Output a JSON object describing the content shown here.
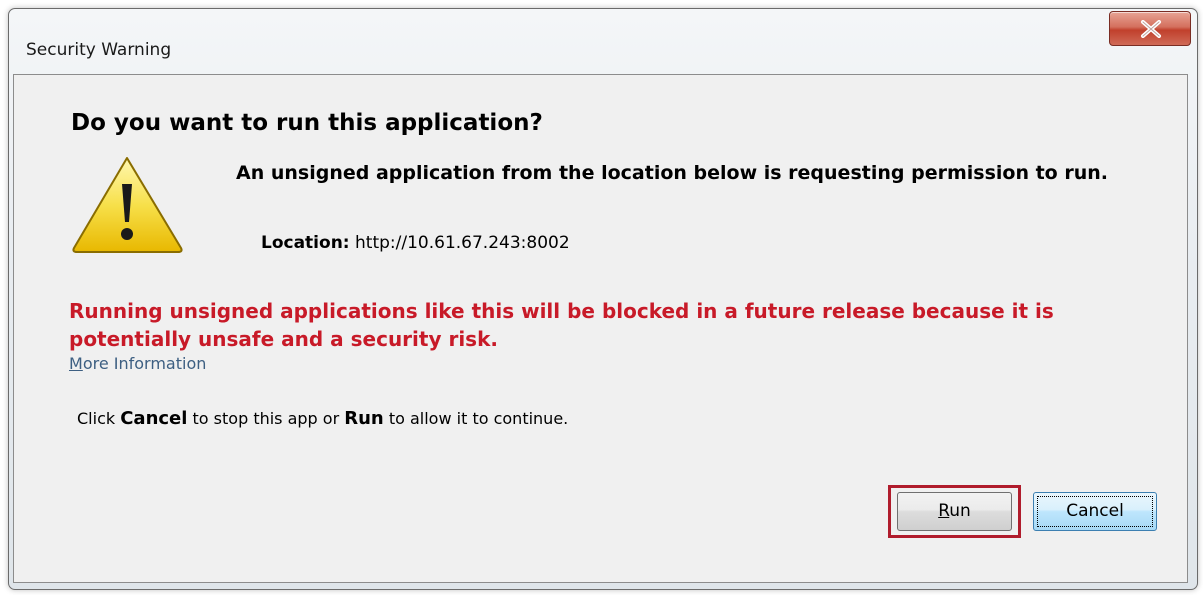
{
  "window": {
    "title": "Security Warning",
    "close_glyph": "X",
    "close_icon": "close-icon"
  },
  "dialog": {
    "heading": "Do you want to run this application?",
    "warning_icon": "warning-triangle-icon",
    "message": "An unsigned application from the location below is requesting permission to run.",
    "location_label": "Location:",
    "location_value": "http://10.61.67.243:8002",
    "risk_warning": "Running unsigned applications like this will be blocked in a future release because it is potentially unsafe and a security risk.",
    "risk_color": "#c81a28",
    "more_info_first": "M",
    "more_info_rest": "ore Information",
    "instruction": {
      "part1": "Click ",
      "cancel_word": "Cancel",
      "part2": " to stop this app or ",
      "run_word": "Run",
      "part3": " to allow it to continue."
    }
  },
  "buttons": {
    "run_first": "R",
    "run_rest": "un",
    "cancel": "Cancel",
    "highlight_color": "#b01c2c"
  }
}
